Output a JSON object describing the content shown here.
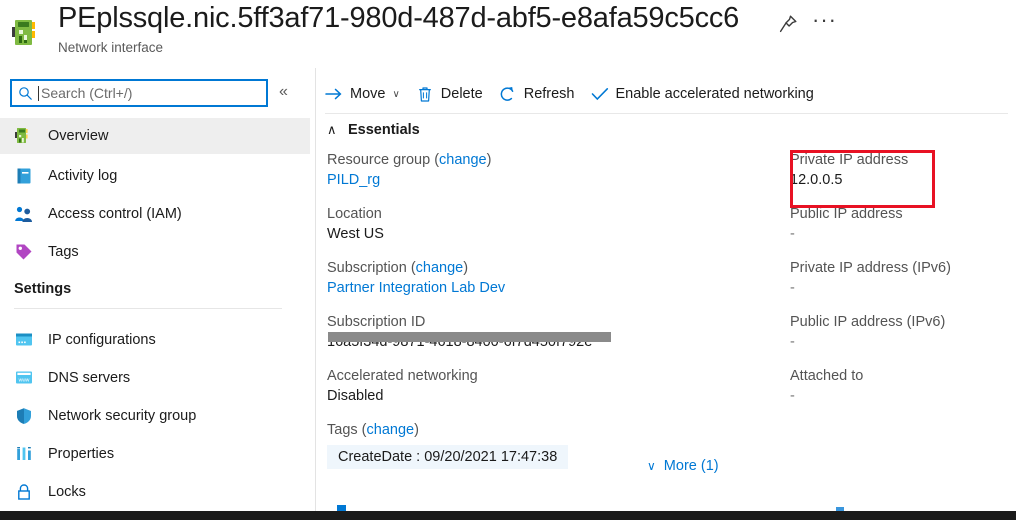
{
  "header": {
    "title": "PEplssqle.nic.5ff3af71-980d-487d-abf5-e8afa59c5cc6",
    "subtitle": "Network interface",
    "resource_icon": "network-interface-icon",
    "pin_icon": "pin-icon",
    "more_icon": "ellipsis-icon",
    "more_label": "···"
  },
  "sidebar": {
    "search": {
      "placeholder": "Search (Ctrl+/)",
      "value": "",
      "icon": "search-icon"
    },
    "collapse_label": "«",
    "items": [
      {
        "label": "Overview",
        "icon": "overview-icon",
        "active": true
      },
      {
        "label": "Activity log",
        "icon": "activity-log-icon",
        "active": false
      },
      {
        "label": "Access control (IAM)",
        "icon": "users-icon",
        "active": false
      },
      {
        "label": "Tags",
        "icon": "tag-icon",
        "active": false
      }
    ],
    "settings_header": "Settings",
    "settings_items": [
      {
        "label": "IP configurations",
        "icon": "ip-config-icon"
      },
      {
        "label": "DNS servers",
        "icon": "dns-icon"
      },
      {
        "label": "Network security group",
        "icon": "shield-icon"
      },
      {
        "label": "Properties",
        "icon": "properties-icon"
      },
      {
        "label": "Locks",
        "icon": "lock-icon"
      }
    ]
  },
  "toolbar": {
    "move_label": "Move",
    "move_icon": "arrow-right-icon",
    "move_chevron": "∨",
    "delete_label": "Delete",
    "delete_icon": "trash-icon",
    "refresh_label": "Refresh",
    "refresh_icon": "refresh-icon",
    "enable_accel_label": "Enable accelerated networking",
    "enable_accel_icon": "checkmark-icon"
  },
  "essentials": {
    "section_label": "Essentials",
    "collapse_chevron": "∧",
    "left_column": [
      {
        "label": "Resource group",
        "change_label": "change",
        "has_change": true,
        "value": "PILD_rg",
        "is_link": true
      },
      {
        "label": "Location",
        "has_change": false,
        "value": "West US",
        "is_link": false
      },
      {
        "label": "Subscription",
        "change_label": "change",
        "has_change": true,
        "value": "Partner Integration Lab Dev",
        "is_link": true
      },
      {
        "label": "Subscription ID",
        "has_change": false,
        "value": "16a5f34d-9871-4618-8400-6f7d450f792e",
        "is_link": false,
        "redacted": true
      },
      {
        "label": "Accelerated networking",
        "has_change": false,
        "value": "Disabled",
        "is_link": false
      }
    ],
    "tags": {
      "label": "Tags",
      "change_label": "change",
      "pill": "CreateDate : 09/20/2021 17:47:38"
    },
    "right_column": [
      {
        "label": "Private IP address",
        "value": "12.0.0.5",
        "highlighted": true
      },
      {
        "label": "Public IP address",
        "value": "-",
        "highlighted": false
      },
      {
        "label": "Private IP address (IPv6)",
        "value": "-",
        "highlighted": false
      },
      {
        "label": "Public IP address (IPv6)",
        "value": "-",
        "highlighted": false
      },
      {
        "label": "Attached to",
        "value": "-",
        "highlighted": false
      }
    ],
    "more_label": "More (1)",
    "more_chevron": "∨"
  },
  "annotation": {
    "highlight_color": "#e81123",
    "target": "Private IP address"
  },
  "colors": {
    "accent": "#0078d4",
    "link": "#0078d4",
    "tag_pill_bg": "#eff6fc",
    "active_nav_bg": "#eeeeee",
    "redaction": "#8a8a8a"
  }
}
